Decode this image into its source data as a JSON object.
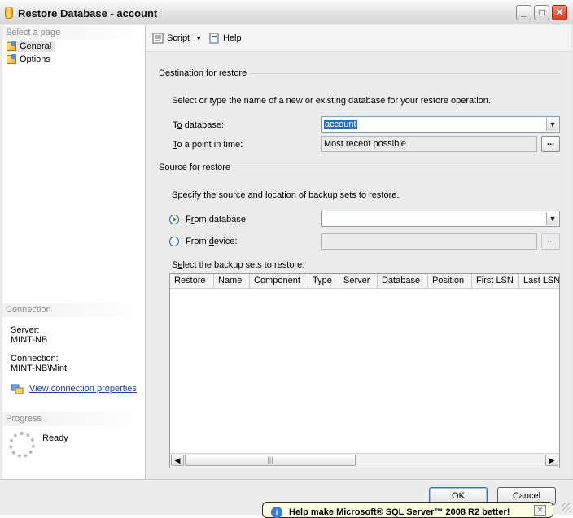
{
  "window": {
    "title": "Restore Database - account",
    "icon": "database-cylinder-icon",
    "controls": [
      "minimize",
      "maximize",
      "close"
    ]
  },
  "sidebar": {
    "select_page_header": "Select a page",
    "pages": [
      {
        "label": "General",
        "selected": true
      },
      {
        "label": "Options",
        "selected": false
      }
    ],
    "connection_header": "Connection",
    "server_label": "Server:",
    "server_value": "MINT-NB",
    "connection_label": "Connection:",
    "connection_value": "MINT-NB\\Mint",
    "connection_link": "View connection properties",
    "progress_header": "Progress",
    "progress_status": "Ready"
  },
  "toolbar": {
    "script_label": "Script",
    "help_label": "Help"
  },
  "destination": {
    "group_label": "Destination for restore",
    "description": "Select or type the name of a new or existing database for your restore operation.",
    "to_database_label_pre": "T",
    "to_database_label_key": "o",
    "to_database_label_post": " database:",
    "to_database_value": "account",
    "point_in_time_label_key": "T",
    "point_in_time_label_post": "o a point in time:",
    "point_in_time_value": "Most recent possible",
    "browse_label": "..."
  },
  "source": {
    "group_label": "Source for restore",
    "description": "Specify the source and location of backup sets to restore.",
    "from_database_label_pre": "F",
    "from_database_label_key": "r",
    "from_database_label_post": "om database:",
    "from_database_value": "",
    "from_device_label_pre": "From ",
    "from_device_label_key": "d",
    "from_device_label_post": "evice:",
    "from_device_value": "",
    "browse_label": "...",
    "selected_option": "From database"
  },
  "backup_sets": {
    "label_pre": "S",
    "label_key": "e",
    "label_post": "lect the backup sets to restore:",
    "columns": [
      "Restore",
      "Name",
      "Component",
      "Type",
      "Server",
      "Database",
      "Position",
      "First LSN",
      "Last LSN"
    ],
    "rows": []
  },
  "buttons": {
    "ok": "OK",
    "cancel": "Cancel"
  },
  "notification": {
    "text": "Help make Microsoft® SQL Server™ 2008 R2 better!",
    "icon": "info-icon"
  },
  "colors": {
    "link": "#1c3fa7",
    "selection": "#316ac5",
    "radio_dot": "#22a322"
  }
}
